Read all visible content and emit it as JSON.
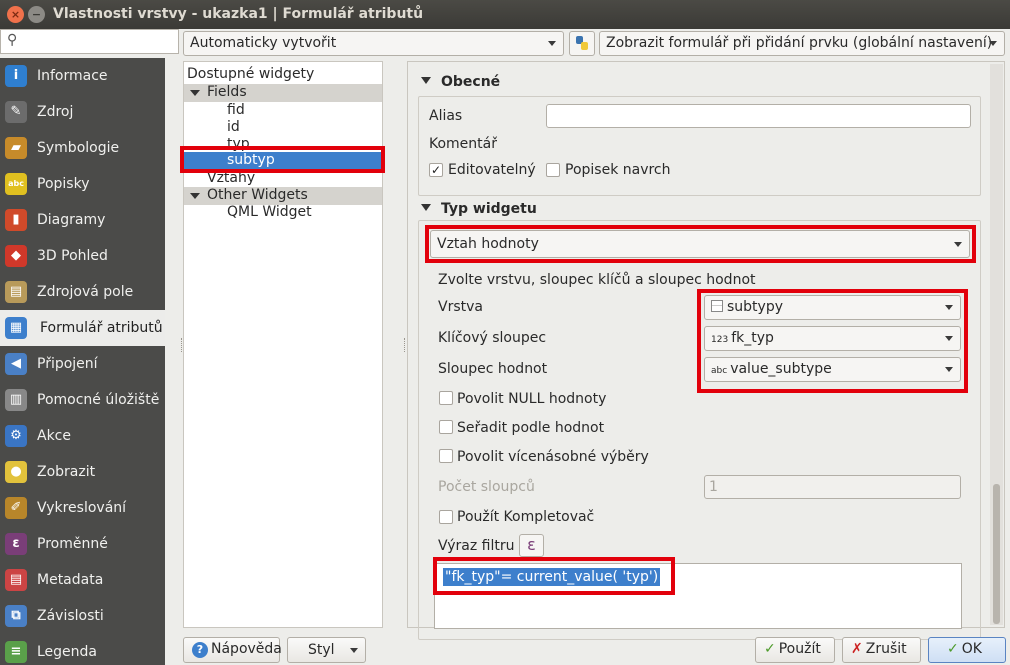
{
  "window": {
    "title": "Vlastnosti vrstvy - ukazka1 | Formulář atributů",
    "close": "×",
    "minimize": "−"
  },
  "search": {
    "placeholder": ""
  },
  "sidebar": {
    "items": [
      {
        "label": "Informace",
        "icon": "info-icon",
        "glyph": "i",
        "color": "#2f7fd0"
      },
      {
        "label": "Zdroj",
        "icon": "wrench-icon",
        "glyph": "✎",
        "color": "#6c6c6c"
      },
      {
        "label": "Symbologie",
        "icon": "paintbrush-icon",
        "glyph": "▰",
        "color": "#c78b2a"
      },
      {
        "label": "Popisky",
        "icon": "labels-abc-icon",
        "glyph": "abc",
        "color": "#e0c020"
      },
      {
        "label": "Diagramy",
        "icon": "diagram-icon",
        "glyph": "▮",
        "color": "#d04a2a"
      },
      {
        "label": "3D Pohled",
        "icon": "cube-3d-icon",
        "glyph": "◆",
        "color": "#d0382a"
      },
      {
        "label": "Zdrojová pole",
        "icon": "fields-icon",
        "glyph": "▤",
        "color": "#b89a5a"
      },
      {
        "label": "Formulář atributů",
        "icon": "form-icon",
        "glyph": "▦",
        "color": "#3d7fcc"
      },
      {
        "label": "Připojení",
        "icon": "join-icon",
        "glyph": "◀",
        "color": "#4a80c6"
      },
      {
        "label": "Pomocné úložiště",
        "icon": "storage-icon",
        "glyph": "▥",
        "color": "#888"
      },
      {
        "label": "Akce",
        "icon": "action-gear-icon",
        "glyph": "⚙",
        "color": "#3a75c4"
      },
      {
        "label": "Zobrazit",
        "icon": "speech-bubble-icon",
        "glyph": "●",
        "color": "#e2c23c"
      },
      {
        "label": "Vykreslování",
        "icon": "brush-icon",
        "glyph": "✐",
        "color": "#b8862a"
      },
      {
        "label": "Proměnné",
        "icon": "epsilon-icon",
        "glyph": "ε",
        "color": "#7a3e78"
      },
      {
        "label": "Metadata",
        "icon": "metadata-icon",
        "glyph": "▤",
        "color": "#c44"
      },
      {
        "label": "Závislosti",
        "icon": "dependency-icon",
        "glyph": "⧉",
        "color": "#4a80c6"
      },
      {
        "label": "Legenda",
        "icon": "legend-icon",
        "glyph": "≡",
        "color": "#5aa04a"
      }
    ]
  },
  "top": {
    "layout_combo": "Automaticky vytvořit",
    "form_combo": "Zobrazit formulář při přidání prvku (globální nastavení)"
  },
  "tree": {
    "title": "Dostupné widgety",
    "fields_label": "Fields",
    "fields": [
      "fid",
      "id",
      "typ",
      "subtyp"
    ],
    "relations_label": "Vztahy",
    "other_label": "Other Widgets",
    "other": [
      "QML Widget"
    ]
  },
  "general": {
    "header": "Obecné",
    "alias_label": "Alias",
    "alias_value": "",
    "comment_label": "Komentář",
    "editable_label": "Editovatelný",
    "editable_checked": "✓",
    "label_on_top": "Popisek navrch"
  },
  "widget_type": {
    "header": "Typ widgetu",
    "selected": "Vztah hodnoty",
    "description": "Zvolte vrstvu, sloupec klíčů a sloupec hodnot",
    "layer_label": "Vrstva",
    "layer_value": "subtypy",
    "key_label": "Klíčový sloupec",
    "key_prefix": "123",
    "key_value": "fk_typ",
    "value_label": "Sloupec hodnot",
    "value_prefix": "abc",
    "value_value": "value_subtype",
    "allow_null": "Povolit NULL hodnoty",
    "sort_by_value": "Seřadit podle hodnot",
    "allow_multiple": "Povolit vícenásobné výběry",
    "columns_label": "Počet sloupců",
    "columns_value": "1",
    "use_completer": "Použít Kompletovač",
    "filter_label": "Výraz filtru",
    "filter_expr": "\"fk_typ\"= current_value( 'typ')"
  },
  "buttons": {
    "help": "Nápověda",
    "style": "Styl",
    "apply": "Použít",
    "cancel": "Zrušit",
    "ok": "OK"
  },
  "colors": {
    "highlight_red": "#e2000b",
    "selection_blue": "#3d7fcc"
  }
}
